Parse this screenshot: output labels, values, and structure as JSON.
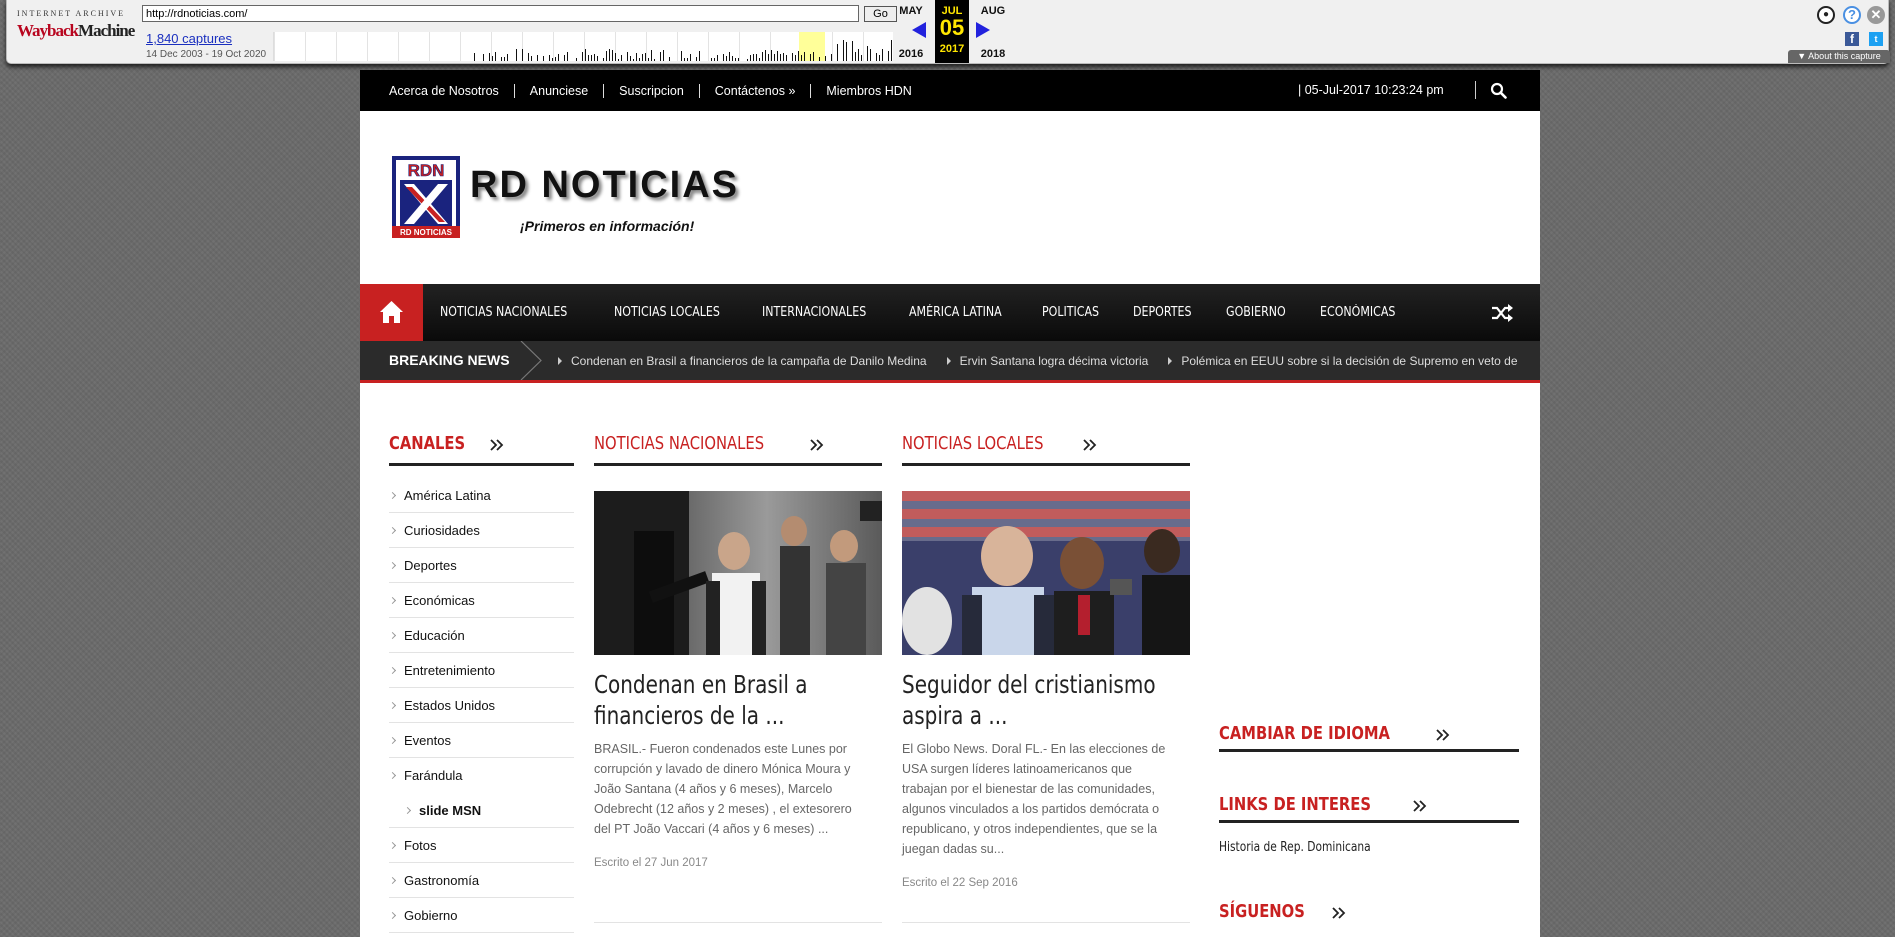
{
  "wayback": {
    "logo_top": "INTERNET ARCHIVE",
    "logo_main_1": "Wayback",
    "logo_main_2": "Machine",
    "url": "http://rdnoticias.com/",
    "go_label": "Go",
    "captures": "1,840 captures",
    "range": "14 Dec 2003 - 19 Oct 2020",
    "prev_month": "MAY",
    "cur_month": "JUL",
    "next_month": "AUG",
    "cur_day": "05",
    "prev_year": "2016",
    "cur_year": "2017",
    "next_year": "2018",
    "about_label": "▼ About this capture",
    "fb_label": "f",
    "tw_label": "t"
  },
  "topbar": {
    "links": [
      "Acerca de Nosotros",
      "Anunciese",
      "Suscripcion",
      "Contáctenos »",
      "Miembros HDN"
    ],
    "datetime": "| 05-Jul-2017 10:23:24 pm"
  },
  "header": {
    "logo_title": "RD NOTICIAS",
    "logo_tag": "¡Primeros en información!",
    "badge_top": "RDN",
    "badge_bottom": "RD NOTICIAS"
  },
  "mainnav": [
    "NOTICIAS NACIONALES",
    "NOTICIAS LOCALES",
    "INTERNACIONALES",
    "AMÉRICA LATINA",
    "POLITICAS",
    "DEPORTES",
    "GOBIERNO",
    "ECONÓMICAS"
  ],
  "breaking": {
    "label": "BREAKING NEWS",
    "items": [
      "Condenan en Brasil a financieros de la campaña de Danilo Medina",
      "Ervin Santana logra décima victoria",
      "Polémica en EEUU sobre si la decisión de Supremo en veto de"
    ]
  },
  "canales": {
    "title": "CANALES",
    "items": [
      "América Latina",
      "Curiosidades",
      "Deportes",
      "Económicas",
      "Educación",
      "Entretenimiento",
      "Estados Unidos",
      "Eventos",
      "Farándula",
      "slide MSN",
      "Fotos",
      "Gastronomía",
      "Gobierno"
    ]
  },
  "columns": [
    {
      "section": "NOTICIAS NACIONALES",
      "title": "Condenan en Brasil a financieros de la ...",
      "excerpt": "BRASIL.- Fueron condenados este Lunes por corrupción y lavado de dinero Mónica Moura y João Santana (4 años y 6 meses), Marcelo Odebrecht (12 años y 2 meses) , el extesorero del PT João Vaccari (4 años y 6 meses) ...",
      "date": "Escrito el 27 Jun 2017"
    },
    {
      "section": "NOTICIAS LOCALES",
      "title": "Seguidor del cristianismo aspira a ...",
      "excerpt": "El Globo News. Doral FL.-  En las elecciones de USA surgen líderes latinoamericanos que trabajan por el bienestar de las comunidades, algunos vinculados a los partidos demócrata o republicano, y otros independientes, que se la juegan dadas su...",
      "date": "Escrito el 22 Sep 2016"
    }
  ],
  "sidebar": {
    "idioma": "CAMBIAR DE IDIOMA",
    "links_title": "LINKS DE INTERES",
    "link_1": "Historia de Rep. Dominicana",
    "siguenos": "SÍGUENOS"
  },
  "colors": {
    "accent": "#c82121",
    "wayback_blue": "#2222dd",
    "wayback_current": "#ffe600"
  }
}
